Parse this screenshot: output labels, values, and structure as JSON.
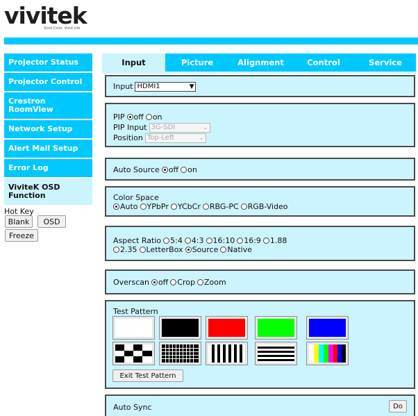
{
  "logo": {
    "word": "vivitek",
    "tagline": "Vivid Color. Vivid Life"
  },
  "sidebar": {
    "items": [
      {
        "label": "Projector Status"
      },
      {
        "label": "Projector Control"
      },
      {
        "label": "Crestron RoomView"
      },
      {
        "label": "Network Setup"
      },
      {
        "label": "Alert Mail Setup"
      },
      {
        "label": "Error Log"
      },
      {
        "label": "ViviteK OSD Function"
      }
    ],
    "hotkey": {
      "label": "Hot Key",
      "blank": "Blank",
      "osd": "OSD",
      "freeze": "Freeze"
    }
  },
  "tabs": [
    {
      "label": "Input"
    },
    {
      "label": "Picture"
    },
    {
      "label": "Alignment"
    },
    {
      "label": "Control"
    },
    {
      "label": "Service"
    }
  ],
  "input": {
    "label": "Input",
    "value": "HDMI1"
  },
  "pip": {
    "label": "PIP",
    "off": "off",
    "on": "on",
    "input_label": "PIP Input",
    "input_value": "3G-SDI",
    "position_label": "Position",
    "position_value": "Top-Left"
  },
  "auto_source": {
    "label": "Auto Source",
    "off": "off",
    "on": "on"
  },
  "color_space": {
    "label": "Color Space",
    "options": [
      "Auto",
      "YPbPr",
      "YCbCr",
      "RBG-PC",
      "RGB-Video"
    ],
    "selected": "Auto"
  },
  "aspect_ratio": {
    "label": "Aspect Ratio",
    "options": [
      "5:4",
      "4:3",
      "16:10",
      "16:9",
      "1.88",
      "2.35",
      "LetterBox",
      "Source",
      "Native"
    ],
    "selected": "Source"
  },
  "overscan": {
    "label": "Overscan",
    "options": [
      "off",
      "Crop",
      "Zoom"
    ],
    "selected": "off"
  },
  "test_pattern": {
    "label": "Test Pattern",
    "exit_label": "Exit Test Pattern",
    "patterns": [
      "white",
      "black",
      "red",
      "green",
      "blue",
      "checkerboard",
      "grid",
      "vertical-lines",
      "horizontal-lines",
      "color-bars"
    ]
  },
  "auto_sync": {
    "label": "Auto Sync",
    "button": "Do"
  },
  "colors": {
    "accent": "#00c8ff",
    "panel": "#ccf4ff",
    "red": "#ff0000",
    "green": "#00ff00",
    "blue": "#0000ff"
  }
}
